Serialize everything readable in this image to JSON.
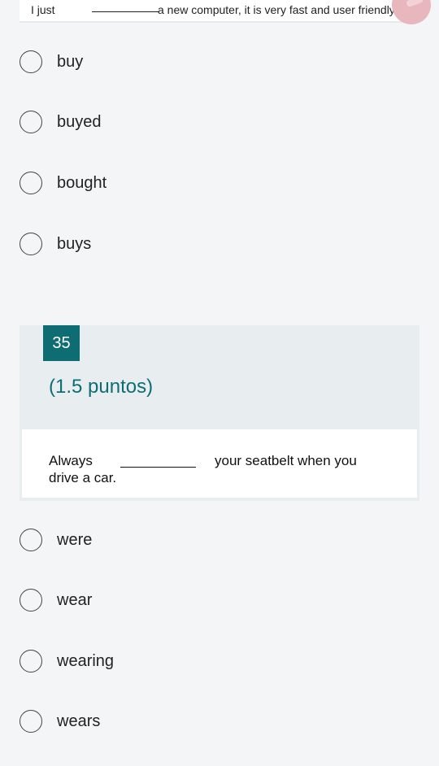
{
  "prev_question": {
    "text_before": "I just",
    "blank": "________",
    "text_after": "a new computer, it is very fast and user friendly."
  },
  "prev_options": [
    "buy",
    "buyed",
    "bought",
    "buys"
  ],
  "question": {
    "number": "35",
    "points": "(1.5 puntos)",
    "stem_start": "Always",
    "stem_mid": "your seatbelt when you",
    "stem_end": "drive a car."
  },
  "options": [
    "were",
    "wear",
    "wearing",
    "wears"
  ],
  "colors": {
    "accent": "#0d6d72",
    "card_bg": "#e8eef0",
    "page_bg": "#f3f5f6"
  }
}
